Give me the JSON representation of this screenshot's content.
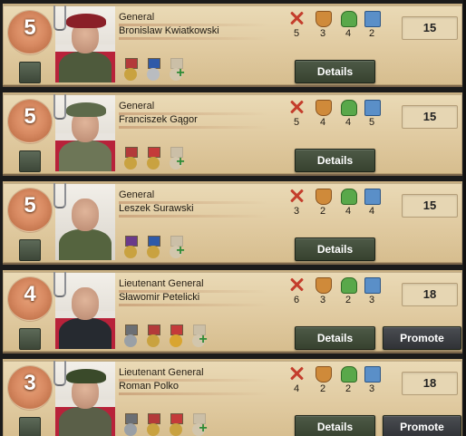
{
  "generals": [
    {
      "skill": "5",
      "rank": "General",
      "name": "Bronislaw Kwiatkowski",
      "stats": {
        "attack": "5",
        "defense": "3",
        "planning": "4",
        "logistics": "2"
      },
      "xp": "15",
      "details_label": "Details",
      "promote_label": "",
      "portrait": {
        "hat": "#8a2028",
        "uniform": "#4e5a3c",
        "flag": true
      },
      "medals": [
        {
          "ribbon": "#b33a3a",
          "disc": "#c9a240"
        },
        {
          "ribbon": "#2f5aa8",
          "disc": "#b9bcc0"
        }
      ]
    },
    {
      "skill": "5",
      "rank": "General",
      "name": "Franciszek Gągor",
      "stats": {
        "attack": "5",
        "defense": "4",
        "planning": "4",
        "logistics": "5"
      },
      "xp": "15",
      "details_label": "Details",
      "promote_label": "",
      "portrait": {
        "hat": "#5d6a4a",
        "uniform": "#6d7657",
        "flag": true
      },
      "medals": [
        {
          "ribbon": "#b33a3a",
          "disc": "#c9a240"
        },
        {
          "ribbon": "#c43a3a",
          "disc": "#c9a240"
        }
      ]
    },
    {
      "skill": "5",
      "rank": "General",
      "name": "Leszek Surawski",
      "stats": {
        "attack": "3",
        "defense": "2",
        "planning": "4",
        "logistics": "4"
      },
      "xp": "15",
      "details_label": "Details",
      "promote_label": "",
      "portrait": {
        "hat": "",
        "uniform": "#55643f",
        "flag": false
      },
      "medals": [
        {
          "ribbon": "#6a3a8a",
          "disc": "#c9a240"
        },
        {
          "ribbon": "#2f5aa8",
          "disc": "#c9a240"
        }
      ]
    },
    {
      "skill": "4",
      "rank": "Lieutenant General",
      "name": "Sławomir Petelicki",
      "stats": {
        "attack": "6",
        "defense": "3",
        "planning": "2",
        "logistics": "3"
      },
      "xp": "18",
      "details_label": "Details",
      "promote_label": "Promote",
      "portrait": {
        "hat": "",
        "uniform": "#262a30",
        "flag": true
      },
      "medals": [
        {
          "ribbon": "#6b6f74",
          "disc": "#9aa0a6"
        },
        {
          "ribbon": "#b33a3a",
          "disc": "#c9a240"
        },
        {
          "ribbon": "#c43a3a",
          "disc": "#d9a530"
        }
      ]
    },
    {
      "skill": "3",
      "rank": "Lieutenant General",
      "name": "Roman Polko",
      "stats": {
        "attack": "4",
        "defense": "2",
        "planning": "2",
        "logistics": "3"
      },
      "xp": "18",
      "details_label": "Details",
      "promote_label": "Promote",
      "portrait": {
        "hat": "#3a4a2a",
        "uniform": "#5a5f48",
        "flag": true
      },
      "medals": [
        {
          "ribbon": "#6b6f74",
          "disc": "#9aa0a6"
        },
        {
          "ribbon": "#b33a3a",
          "disc": "#c9a240"
        },
        {
          "ribbon": "#c43a3a",
          "disc": "#c9a240"
        }
      ]
    }
  ]
}
